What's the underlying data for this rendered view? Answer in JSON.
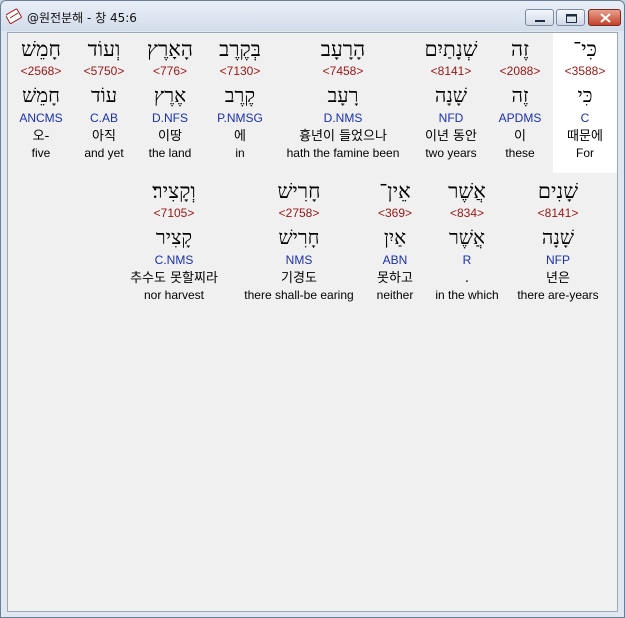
{
  "window": {
    "title": "@원전분해 - 창 45:6"
  },
  "rows": [
    {
      "words": [
        {
          "hebrew": "כִּי־",
          "strong": "<3588>",
          "lemma": "כִּי",
          "morph": "C",
          "korean": "때문에",
          "english": "For",
          "highlighted": true
        },
        {
          "hebrew": "זֶה",
          "strong": "<2088>",
          "lemma": "זֶה",
          "morph": "APDMS",
          "korean": "이",
          "english": "these"
        },
        {
          "hebrew": "שְׁנָתַיִם",
          "strong": "<8141>",
          "lemma": "שָׁנָה",
          "morph": "NFD",
          "korean": "이년 동안",
          "english": "two years"
        },
        {
          "hebrew": "הָרָעָב",
          "strong": "<7458>",
          "lemma": "רָעָב",
          "morph": "D.NMS",
          "korean": "흉년이 들었으나",
          "english": "hath the famine been"
        },
        {
          "hebrew": "בְּקֶרֶב",
          "strong": "<7130>",
          "lemma": "קֶרֶב",
          "morph": "P.NMSG",
          "korean": "에",
          "english": "in"
        },
        {
          "hebrew": "הָאָרֶץ",
          "strong": "<776>",
          "lemma": "אֶרֶץ",
          "morph": "D.NFS",
          "korean": "이땅",
          "english": "the land"
        },
        {
          "hebrew": "וְעוֹד",
          "strong": "<5750>",
          "lemma": "עוֹד",
          "morph": "C.AB",
          "korean": "아직",
          "english": "and yet"
        },
        {
          "hebrew": "חָמֵשׁ",
          "strong": "<2568>",
          "lemma": "חָמֵשׁ",
          "morph": "ANCMS",
          "korean": "오-",
          "english": "five"
        }
      ]
    },
    {
      "words": [
        {
          "hebrew": "שָׁנִים",
          "strong": "<8141>",
          "lemma": "שָׁנָה",
          "morph": "NFP",
          "korean": "년은",
          "english": "there are-years"
        },
        {
          "hebrew": "אֲשֶׁר",
          "strong": "<834>",
          "lemma": "אֲשֶׁר",
          "morph": "R",
          "korean": ".",
          "english": "in the which"
        },
        {
          "hebrew": "אֵין־",
          "strong": "<369>",
          "lemma": "אַיִן",
          "morph": "ABN",
          "korean": "못하고",
          "english": "neither"
        },
        {
          "hebrew": "חָרִישׁ",
          "strong": "<2758>",
          "lemma": "חָרִישׁ",
          "morph": "NMS",
          "korean": "기경도",
          "english": "there shall-be earing"
        },
        {
          "hebrew": "וְקָצִיר׃",
          "strong": "<7105>",
          "lemma": "קָצִיר",
          "morph": "C.NMS",
          "korean": "추수도 못할찌라",
          "english": "nor harvest"
        }
      ]
    }
  ]
}
